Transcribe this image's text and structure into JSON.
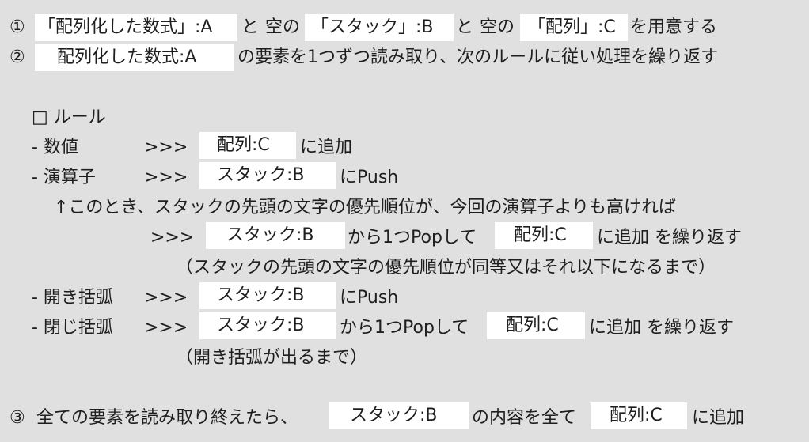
{
  "step1": {
    "marker": "①",
    "boxA": "「配列化した数式」:A",
    "to1": "と",
    "kara1": "空の",
    "boxB": "「スタック」:B",
    "to2": "と",
    "kara2": "空の",
    "boxC": "「配列」:C",
    "tail": "を用意する"
  },
  "step2": {
    "marker": "②",
    "boxA": "配列化した数式:A",
    "tail": "の要素を1つずつ読み取り、次のルールに従い処理を繰り返す"
  },
  "rules": {
    "heading": "□ ルール",
    "number": {
      "label": "- 数値",
      "arrow": ">>>",
      "box": "配列:C",
      "action": "に追加"
    },
    "operator": {
      "label": "- 演算子",
      "arrow": ">>>",
      "box": "スタック:B",
      "action": "にPush",
      "note": "↑このとき、スタックの先頭の文字の優先順位が、今回の演算子よりも高ければ",
      "sub_arrow": ">>>",
      "sub_box1": "スタック:B",
      "sub_mid": "から1つPopして",
      "sub_box2": "配列:C",
      "sub_tail": "に追加 を繰り返す",
      "paren": "（スタックの先頭の文字の優先順位が同等又はそれ以下になるまで）"
    },
    "open_paren": {
      "label": "- 開き括弧",
      "arrow": ">>>",
      "box": "スタック:B",
      "action": "にPush"
    },
    "close_paren": {
      "label": "- 閉じ括弧",
      "arrow": ">>>",
      "box1": "スタック:B",
      "mid": "から1つPopして",
      "box2": "配列:C",
      "tail": "に追加 を繰り返す",
      "paren": "（開き括弧が出るまで）"
    }
  },
  "step3": {
    "marker": "③",
    "lead": "全ての要素を読み取り終えたら、",
    "box1": "スタック:B",
    "mid": "の内容を全て",
    "box2": "配列:C",
    "tail": "に追加"
  }
}
